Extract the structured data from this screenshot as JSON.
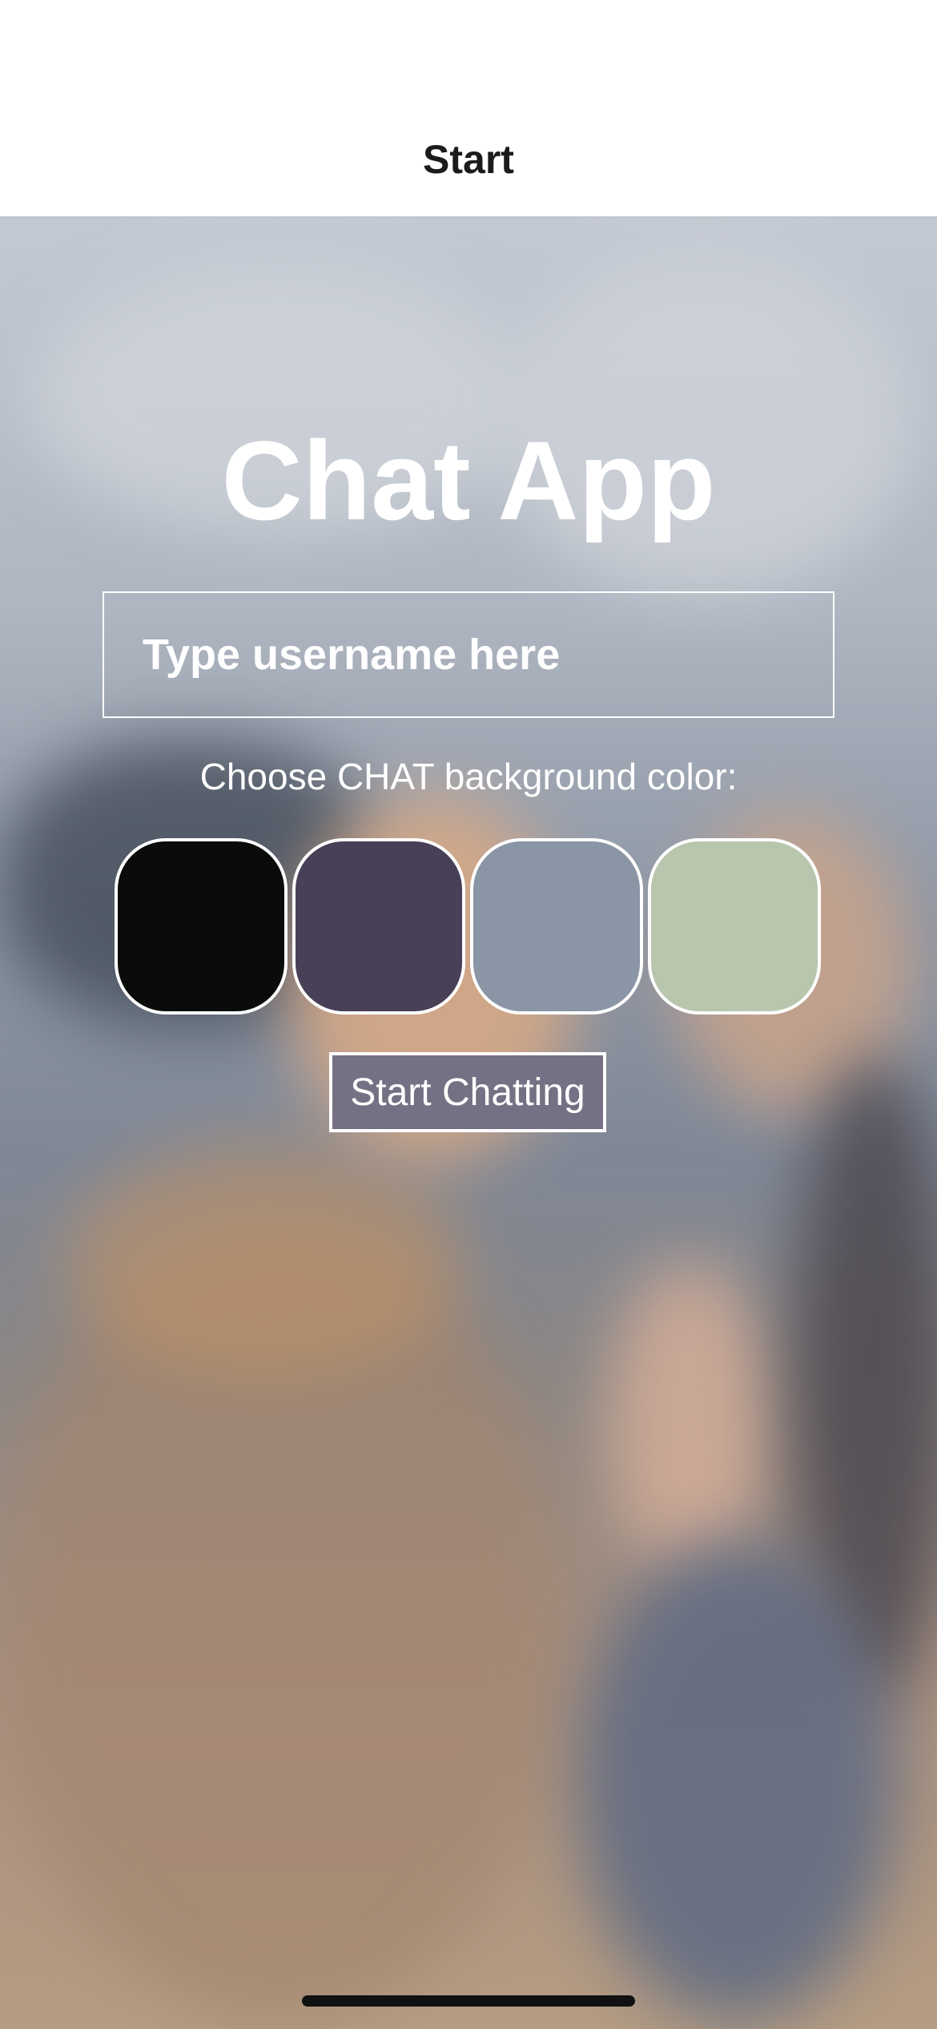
{
  "nav": {
    "title": "Start"
  },
  "main": {
    "app_title": "Chat App",
    "username_input": {
      "value": "",
      "placeholder": "Type username here"
    },
    "color_label": "Choose CHAT background color:",
    "colors": [
      {
        "name": "black",
        "hex": "#090C08"
      },
      {
        "name": "dark purple",
        "hex": "#474056"
      },
      {
        "name": "slate gray",
        "hex": "#8A95A5"
      },
      {
        "name": "sage green",
        "hex": "#B9C6AE"
      }
    ],
    "start_button": {
      "label": "Start Chatting",
      "color": "#757083"
    }
  }
}
